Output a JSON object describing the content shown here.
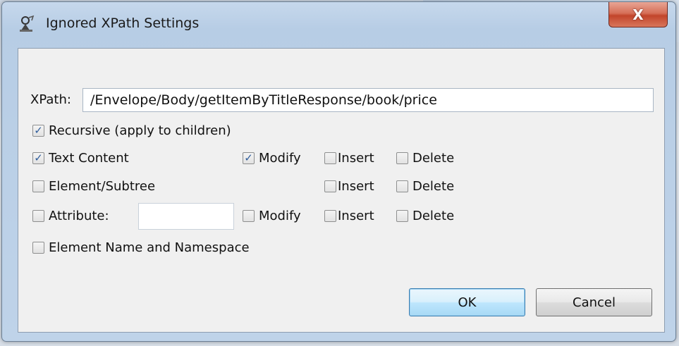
{
  "window": {
    "title": "Ignored XPath Settings",
    "close_label": "X"
  },
  "xpath": {
    "label": "XPath:",
    "value": "/Envelope/Body/getItemByTitleResponse/book/price"
  },
  "options": {
    "recursive": {
      "label": "Recursive (apply to children)",
      "checked": true
    },
    "text_content": {
      "label": "Text Content",
      "checked": true
    },
    "text_modify": {
      "label": "Modify",
      "checked": true
    },
    "text_insert": {
      "label": "Insert",
      "checked": false
    },
    "text_delete": {
      "label": "Delete",
      "checked": false
    },
    "element_subtree": {
      "label": "Element/Subtree",
      "checked": false
    },
    "element_insert": {
      "label": "Insert",
      "checked": false
    },
    "element_delete": {
      "label": "Delete",
      "checked": false
    },
    "attribute": {
      "label": "Attribute:",
      "checked": false,
      "value": ""
    },
    "attribute_modify": {
      "label": "Modify",
      "checked": false
    },
    "attribute_insert": {
      "label": "Insert",
      "checked": false
    },
    "attribute_delete": {
      "label": "Delete",
      "checked": false
    },
    "element_name_ns": {
      "label": "Element Name and Namespace",
      "checked": false
    }
  },
  "buttons": {
    "ok": "OK",
    "cancel": "Cancel"
  },
  "colors": {
    "titlebar": "#bfd3e9",
    "close": "#c2452b",
    "check": "#2f5d9b",
    "default_button_border": "#3c7fb1"
  }
}
